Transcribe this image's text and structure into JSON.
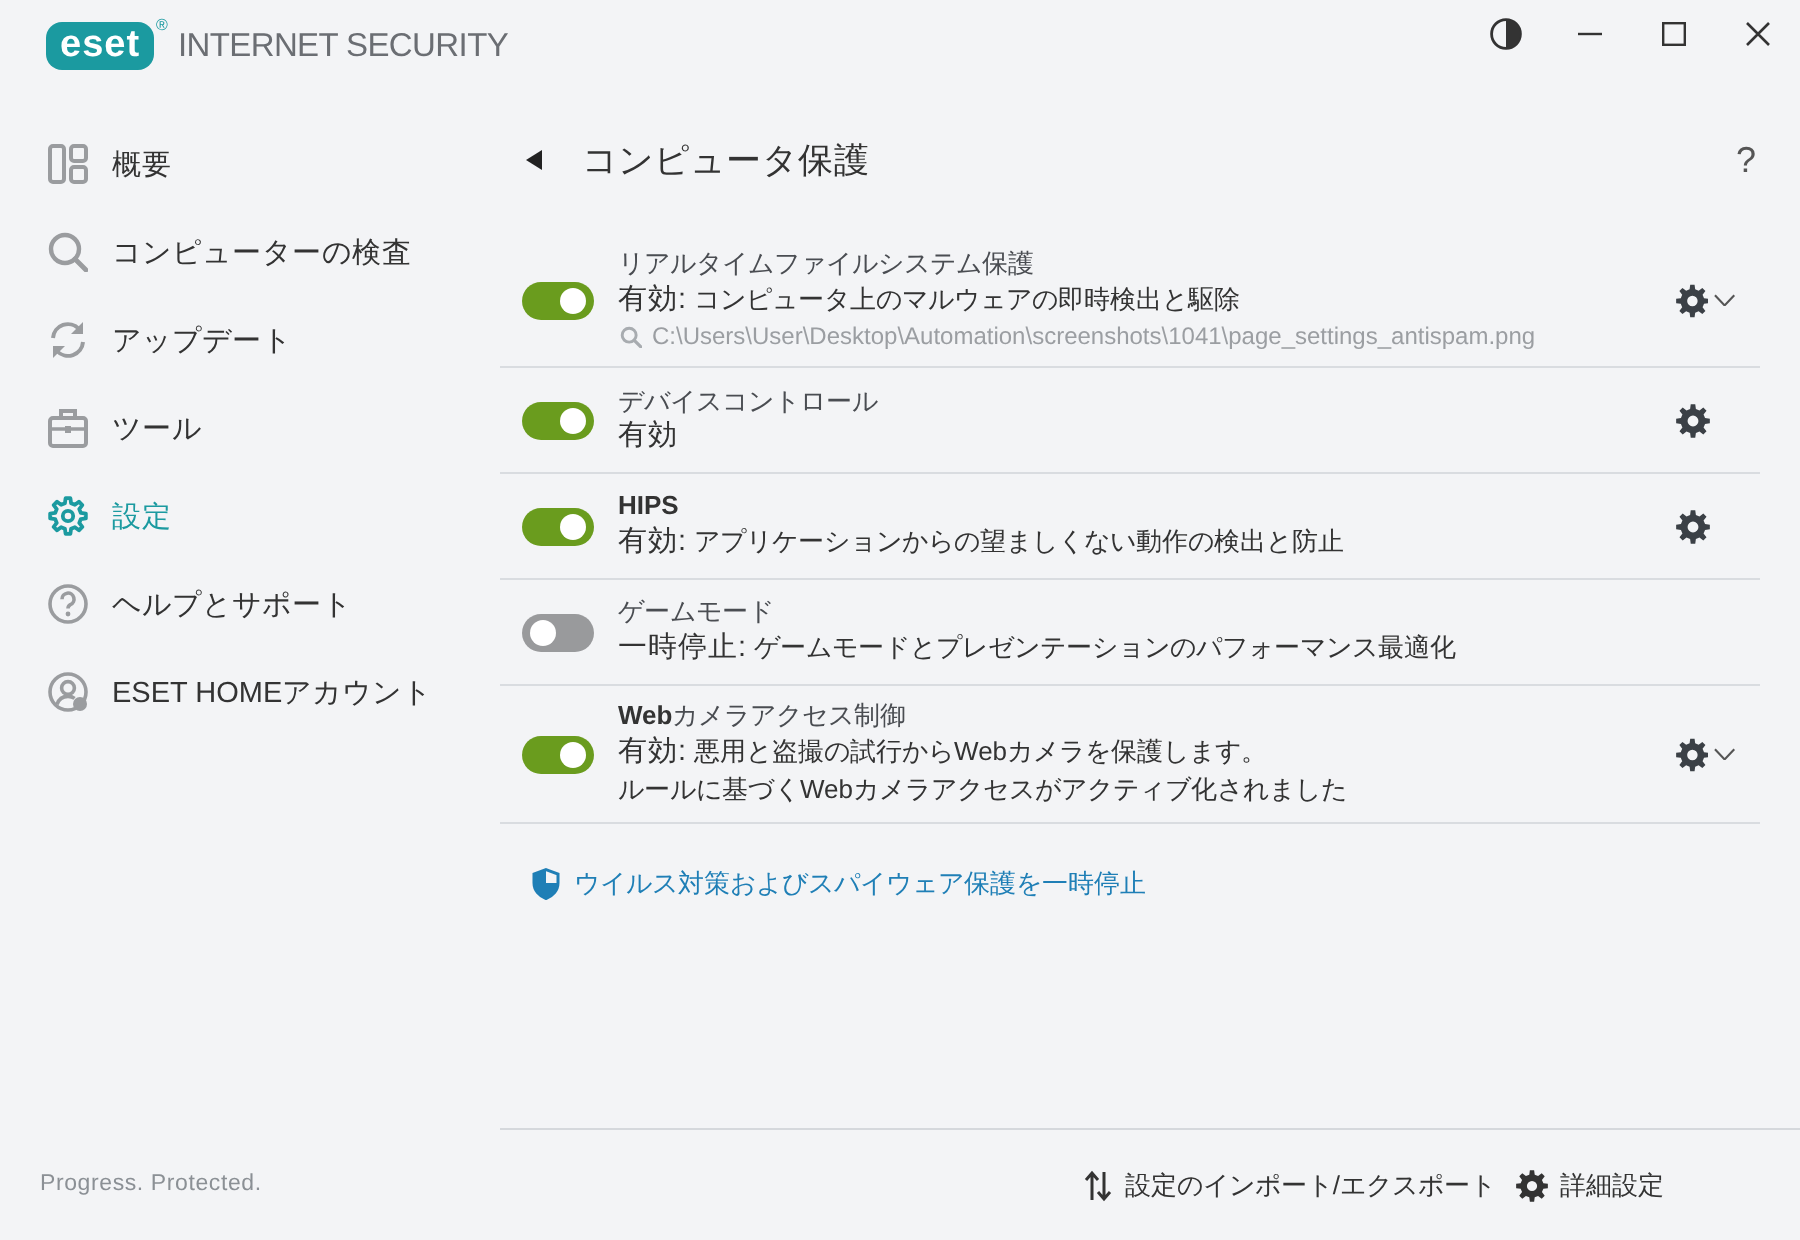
{
  "window": {
    "logo_mark": "eset",
    "logo_registered": "®",
    "product": "INTERNET SECURITY"
  },
  "sidebar": {
    "items": [
      {
        "label": "概要",
        "selected": false
      },
      {
        "label": "コンピューターの検査",
        "selected": false
      },
      {
        "label": "アップデート",
        "selected": false
      },
      {
        "label": "ツール",
        "selected": false
      },
      {
        "label": "設定",
        "selected": true
      },
      {
        "label": "ヘルプとサポート",
        "selected": false
      },
      {
        "label": "ESET HOMEアカウント",
        "selected": false
      }
    ],
    "tagline": "Progress. Protected."
  },
  "page": {
    "title": "コンピュータ保護",
    "help": "?"
  },
  "modules": [
    {
      "title": "リアルタイムファイルシステム保護",
      "enabled": true,
      "status": "有効:",
      "description": "コンピュータ上のマルウェアの即時検出と駆除",
      "path": "C:\\Users\\User\\Desktop\\Automation\\screenshots\\1041\\page_settings_antispam.png",
      "settings": true,
      "dropdown": true
    },
    {
      "title": "デバイスコントロール",
      "enabled": true,
      "status": "有効",
      "settings": true,
      "dropdown": false
    },
    {
      "title": "**HIPS**",
      "enabled": true,
      "status": "有効:",
      "description": "アプリケーションからの望ましくない動作の検出と防止",
      "settings": true,
      "dropdown": false
    },
    {
      "title": "ゲームモード",
      "enabled": false,
      "status": "一時停止:",
      "description": "ゲームモードとプレゼンテーションのパフォーマンス最適化",
      "settings": false,
      "dropdown": false
    },
    {
      "title": "**Web**カメラアクセス制御",
      "enabled": true,
      "status": "有効:",
      "description": "悪用と盗撮の試行からWebカメラを保護します。",
      "note": "ルールに基づくWebカメラアクセスがアクティブ化されました",
      "settings": true,
      "dropdown": true
    }
  ],
  "pause_link": "ウイルス対策およびスパイウェア保護を一時停止",
  "footer": {
    "import_export": "設定のインポート/エクスポート",
    "advanced_setup": "詳細設定"
  }
}
